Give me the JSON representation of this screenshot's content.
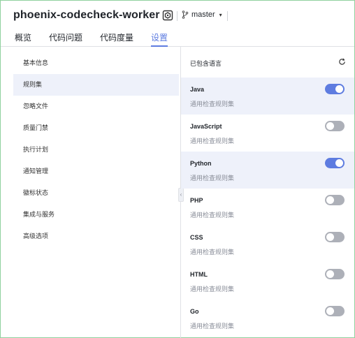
{
  "header": {
    "repo_name": "phoenix-codecheck-worker",
    "branch": "master"
  },
  "tabs": [
    {
      "label": "概览",
      "active": false
    },
    {
      "label": "代码问题",
      "active": false
    },
    {
      "label": "代码度量",
      "active": false
    },
    {
      "label": "设置",
      "active": true
    }
  ],
  "sidebar": {
    "items": [
      {
        "label": "基本信息",
        "active": false
      },
      {
        "label": "规则集",
        "active": true
      },
      {
        "label": "忽略文件",
        "active": false
      },
      {
        "label": "质量门禁",
        "active": false
      },
      {
        "label": "执行计划",
        "active": false
      },
      {
        "label": "通知管理",
        "active": false
      },
      {
        "label": "徽标状态",
        "active": false
      },
      {
        "label": "集成与服务",
        "active": false
      },
      {
        "label": "高级选项",
        "active": false
      }
    ]
  },
  "panel": {
    "title": "已包含语言",
    "languages": [
      {
        "name": "Java",
        "desc": "通用检查规则集",
        "enabled": true
      },
      {
        "name": "JavaScript",
        "desc": "通用检查规则集",
        "enabled": false
      },
      {
        "name": "Python",
        "desc": "通用检查规则集",
        "enabled": true
      },
      {
        "name": "PHP",
        "desc": "通用检查规则集",
        "enabled": false
      },
      {
        "name": "CSS",
        "desc": "通用检查规则集",
        "enabled": false
      },
      {
        "name": "HTML",
        "desc": "通用检查规则集",
        "enabled": false
      },
      {
        "name": "Go",
        "desc": "通用检查规则集",
        "enabled": false
      }
    ]
  },
  "colors": {
    "accent": "#5e7ce0",
    "active_row": "#eef1fa",
    "toggle_off": "#adb0b8"
  },
  "icons": {
    "repo": "repo-icon",
    "branch": "branch-icon",
    "dropdown": "chevron-down-icon",
    "refresh": "refresh-icon",
    "collapse": "chevron-left-icon"
  }
}
